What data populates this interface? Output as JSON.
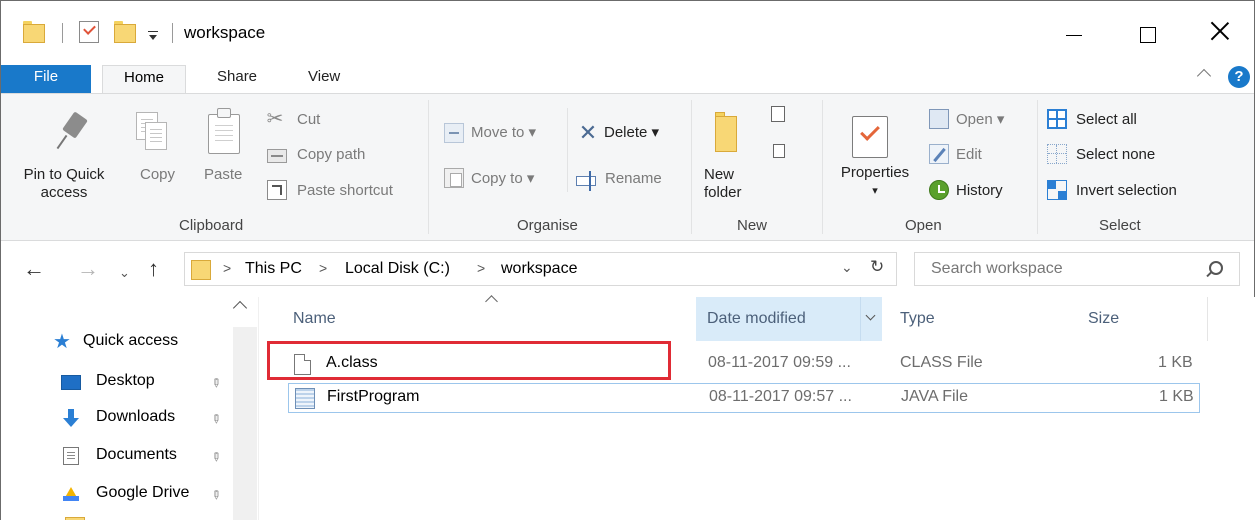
{
  "window": {
    "title": "workspace"
  },
  "ribbon_tabs": {
    "file": "File",
    "home": "Home",
    "share": "Share",
    "view": "View",
    "help": "?"
  },
  "ribbon": {
    "clipboard": {
      "label": "Clipboard",
      "pin_line1": "Pin to Quick",
      "pin_line2": "access",
      "copy": "Copy",
      "paste": "Paste",
      "cut": "Cut",
      "copy_path": "Copy path",
      "paste_shortcut": "Paste shortcut"
    },
    "organise": {
      "label": "Organise",
      "move_to": "Move to ▾",
      "copy_to": "Copy to ▾",
      "delete": "Delete ▾",
      "rename": "Rename"
    },
    "new": {
      "label": "New",
      "new_folder_line1": "New",
      "new_folder_line2": "folder"
    },
    "open": {
      "label": "Open",
      "properties": "Properties",
      "properties_arrow": "▾",
      "open": "Open ▾",
      "edit": "Edit",
      "history": "History"
    },
    "select": {
      "label": "Select",
      "select_all": "Select all",
      "select_none": "Select none",
      "invert_selection": "Invert selection"
    }
  },
  "address": {
    "breadcrumbs": [
      "This PC",
      "Local Disk (C:)",
      "workspace"
    ],
    "separator": ">",
    "search_placeholder": "Search workspace"
  },
  "nav": {
    "quick_access": "Quick access",
    "items": [
      {
        "label": "Desktop",
        "icon": "desktop-icon"
      },
      {
        "label": "Downloads",
        "icon": "downloads-icon"
      },
      {
        "label": "Documents",
        "icon": "documents-icon"
      },
      {
        "label": "Google Drive",
        "icon": "google-drive-icon"
      }
    ]
  },
  "file_list": {
    "columns": [
      "Name",
      "Date modified",
      "Type",
      "Size"
    ],
    "rows": [
      {
        "name": "A.class",
        "date": "08-11-2017 09:59 ...",
        "type": "CLASS File",
        "size": "1 KB",
        "icon": "file-icon"
      },
      {
        "name": "FirstProgram",
        "date": "08-11-2017 09:57 ...",
        "type": "JAVA File",
        "size": "1 KB",
        "icon": "java-file-icon"
      }
    ]
  },
  "colors": {
    "accent": "#1979ca",
    "highlight_box": "#e02b35",
    "header_selected": "#d9ebf9",
    "folder": "#f8d775"
  }
}
